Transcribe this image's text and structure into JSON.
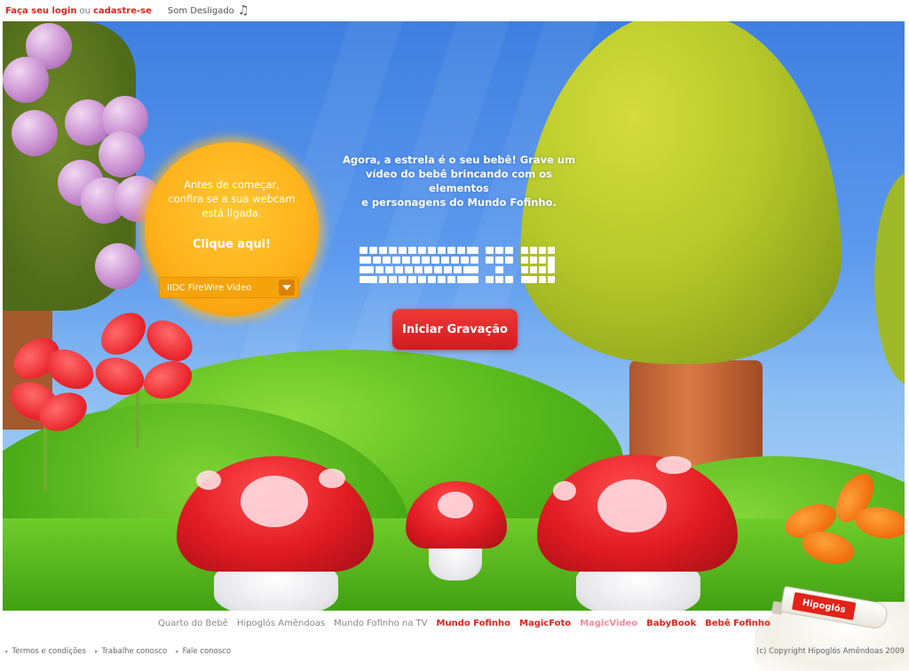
{
  "topbar": {
    "login_label": "Faça seu login",
    "or_label": "ou",
    "signup_label": "cadastre-se",
    "sound_label": "Som Desligado",
    "sound_icon": "music-note-icon"
  },
  "webcam": {
    "line1": "Antes de começar,",
    "line2": "confira se a sua webcam",
    "line3": "está ligada.",
    "cta_label": "Clique aqui!",
    "device_selected": "IIDC FireWire Video"
  },
  "intro": {
    "line1": "Agora, a estrela é o seu bebê! Grave um",
    "line2": "vídeo do bebê brincando com os elementos",
    "line3": "e personagens do Mundo Fofinho."
  },
  "record_button_label": "Iniciar Gravação",
  "product": {
    "brand": "Hipoglós"
  },
  "footer_nav": [
    {
      "label": "Quarto do Bebê",
      "style": "gray"
    },
    {
      "label": "Hipoglós Amêndoas",
      "style": "gray"
    },
    {
      "label": "Mundo Fofinho na TV",
      "style": "gray"
    },
    {
      "label": "Mundo Fofinho",
      "style": "red"
    },
    {
      "label": "MagicFoto",
      "style": "red"
    },
    {
      "label": "MagicVideo",
      "style": "pink"
    },
    {
      "label": "BabyBook",
      "style": "red"
    },
    {
      "label": "Bebê Fofinho",
      "style": "red"
    }
  ],
  "footer_links": {
    "terms": "Termos e condições",
    "jobs": "Trabalhe conosco",
    "contact": "Fale conosco"
  },
  "copyright": "(c) Copyright Hipoglós Amêndoas 2009",
  "colors": {
    "brand_red": "#e2231a",
    "active_pink": "#f28a9a",
    "sky_blue": "#4a8ae6",
    "bubble_orange": "#ffb31c"
  }
}
